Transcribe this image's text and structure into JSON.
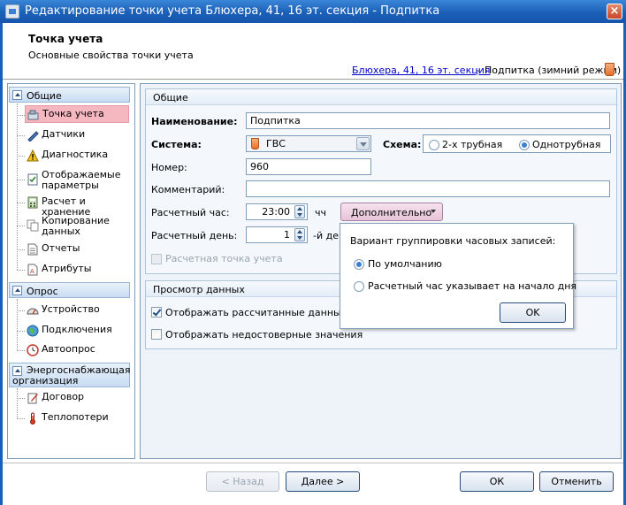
{
  "window": {
    "title": "Редактирование точки учета Блюхера, 41, 16 эт. секция - Подпитка",
    "close_label": "×"
  },
  "header": {
    "title": "Точка учета",
    "subtitle": "Основные свойства точки учета",
    "breadcrumb_link": "Блюхера, 41, 16 эт. секция",
    "breadcrumb_separator": "-",
    "breadcrumb_mode": "Подпитка (зимний режим)"
  },
  "nav": {
    "groups": [
      {
        "label": "Общие",
        "items": [
          "Точка учета",
          "Датчики",
          "Диагностика",
          "Отображаемые параметры",
          "Расчет и хранение",
          "Копирование данных",
          "Отчеты",
          "Атрибуты"
        ]
      },
      {
        "label": "Опрос",
        "items": [
          "Устройство",
          "Подключения",
          "Автоопрос"
        ]
      },
      {
        "label": "Энергоснабжающая организация",
        "items": [
          "Договор",
          "Теплопотери"
        ]
      }
    ],
    "group_labels": [
      "Общие",
      "Опрос",
      "Энергоснабжающая организация"
    ],
    "items": {
      "tochka": "Точка учета",
      "datchiki": "Датчики",
      "diag": "Диагностика",
      "params_1": "Отображаемые",
      "params_2": "параметры",
      "raschet": "Расчет и хранение",
      "copy_1": "Копирование",
      "copy_2": "данных",
      "otchety": "Отчеты",
      "atributy": "Атрибуты",
      "ustroystvo": "Устройство",
      "podkl": "Подключения",
      "avto": "Автоопрос",
      "dogovor": "Договор",
      "teplopoteri": "Теплопотери"
    },
    "group3_line1": "Энергоснабжающая",
    "group3_line2": "организация"
  },
  "general": {
    "section_title": "Общие",
    "name_label": "Наименование:",
    "name_value": "Подпитка",
    "system_label": "Система:",
    "system_value": "ГВС",
    "scheme_label": "Схема:",
    "scheme_options": [
      "2-х трубная",
      "Однотрубная"
    ],
    "scheme_selected": "Однотрубная",
    "number_label": "Номер:",
    "number_value": "960",
    "comment_label": "Комментарий:",
    "comment_value": "",
    "hour_label": "Расчетный час:",
    "hour_value": "23:00",
    "hour_unit": "чч",
    "day_label": "Расчетный день:",
    "day_value": "1",
    "day_unit": "-й ден",
    "point_checkbox_label": "Расчетная точка учета",
    "additional_button": "Дополнительно"
  },
  "popup": {
    "title": "Вариант группировки часовых записей:",
    "option_default": "По умолчанию",
    "option_start": "Расчетный час указывает на начало дня",
    "selected": "По умолчанию",
    "ok_label": "OK"
  },
  "view": {
    "section_title": "Просмотр данных",
    "show_calculated": "Отображать рассчитанные данные",
    "show_calculated_checked": true,
    "show_unreliable": "Отображать недостоверные значения",
    "show_unreliable_checked": false
  },
  "footer": {
    "back_label": "< Назад",
    "next_label": "Далее >",
    "ok_label": "ОК",
    "cancel_label": "Отменить"
  }
}
